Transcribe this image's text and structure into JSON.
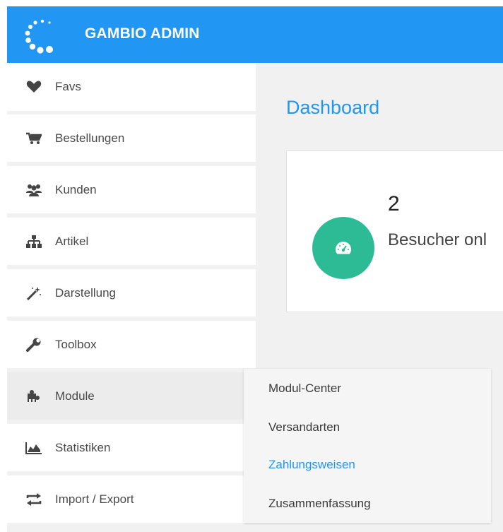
{
  "header": {
    "brand": "GAMBIO ADMIN",
    "logo_icon": "gambio-logo-icon",
    "bg_color": "#2196f3"
  },
  "sidebar": {
    "items": [
      {
        "label": "Favs",
        "icon": "heart-icon"
      },
      {
        "label": "Bestellungen",
        "icon": "cart-icon"
      },
      {
        "label": "Kunden",
        "icon": "users-icon"
      },
      {
        "label": "Artikel",
        "icon": "sitemap-icon"
      },
      {
        "label": "Darstellung",
        "icon": "magic-wand-icon"
      },
      {
        "label": "Toolbox",
        "icon": "wrench-icon"
      },
      {
        "label": "Module",
        "icon": "puzzle-icon",
        "active": true
      },
      {
        "label": "Statistiken",
        "icon": "area-chart-icon"
      },
      {
        "label": "Import / Export",
        "icon": "exchange-icon"
      }
    ]
  },
  "main": {
    "title": "Dashboard",
    "title_color": "#2196f3",
    "widget": {
      "value": "2",
      "label": "Besucher onl",
      "icon": "dashboard-gauge-icon",
      "badge_color": "#2dbb96"
    }
  },
  "submenu": {
    "items": [
      {
        "label": "Modul-Center"
      },
      {
        "label": "Versandarten"
      },
      {
        "label": "Zahlungsweisen",
        "highlighted": true
      },
      {
        "label": "Zusammenfassung"
      }
    ]
  }
}
